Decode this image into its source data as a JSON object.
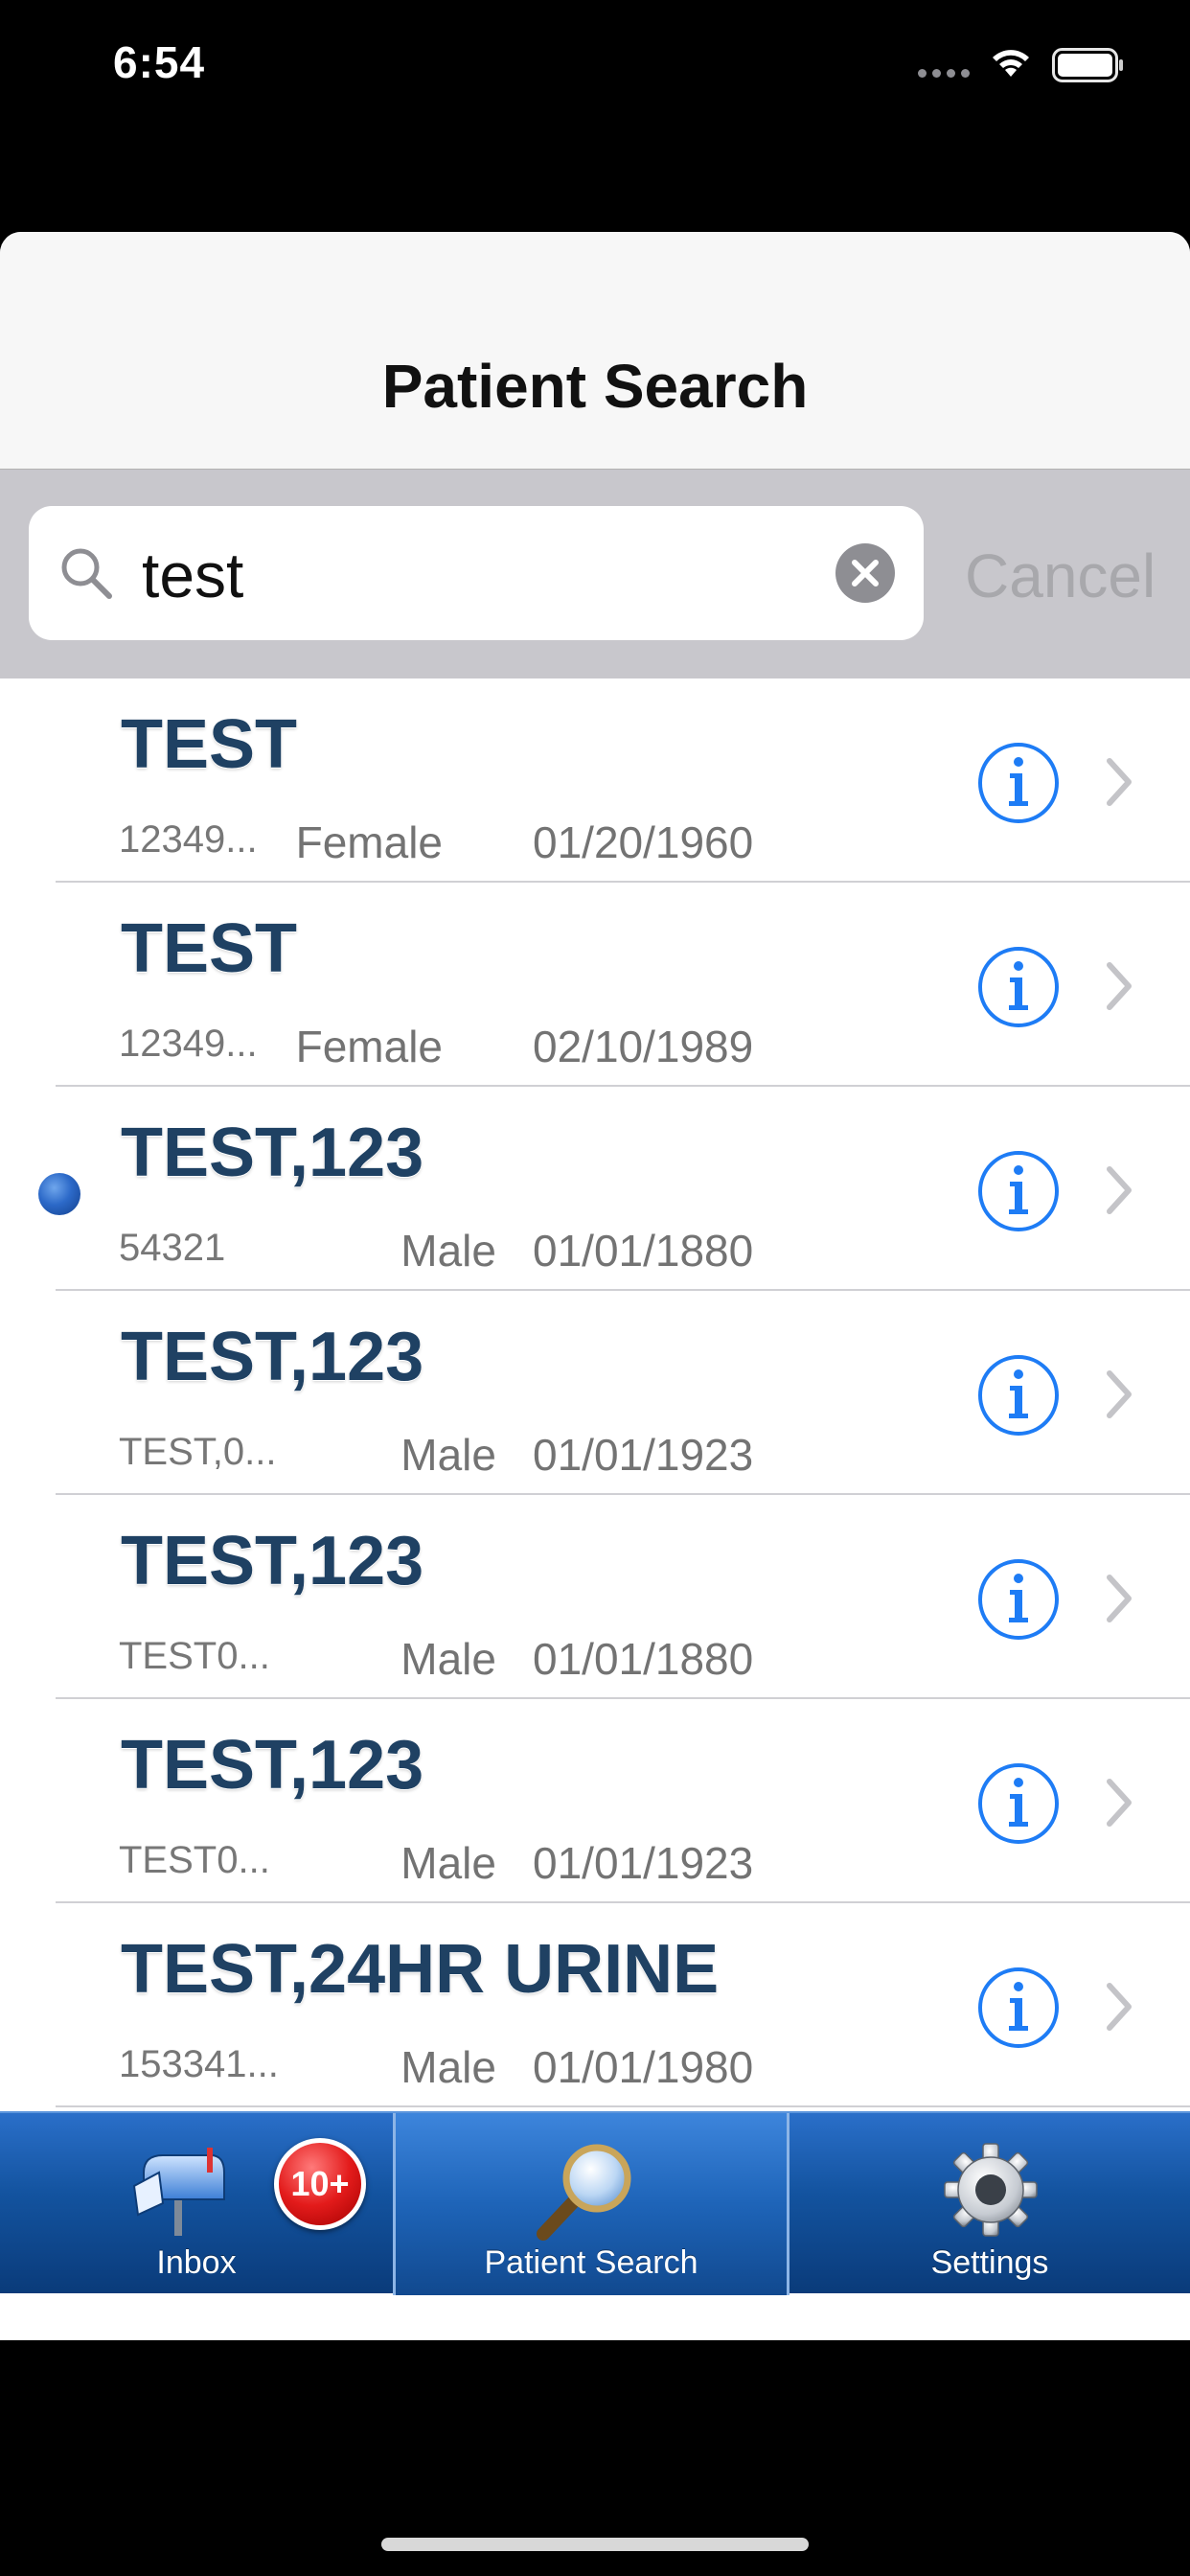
{
  "status_bar": {
    "time": "6:54"
  },
  "nav": {
    "title": "Patient Search"
  },
  "search": {
    "query": "test",
    "cancel_label": "Cancel"
  },
  "patients": [
    {
      "name": "TEST",
      "id": "12349...",
      "gender": "Female",
      "dob": "01/20/1960",
      "selected": false
    },
    {
      "name": "TEST",
      "id": "12349...",
      "gender": "Female",
      "dob": "02/10/1989",
      "selected": false
    },
    {
      "name": "TEST,123",
      "id": "54321",
      "gender": "Male",
      "dob": "01/01/1880",
      "selected": true
    },
    {
      "name": "TEST,123",
      "id": "TEST,0...",
      "gender": "Male",
      "dob": "01/01/1923",
      "selected": false
    },
    {
      "name": "TEST,123",
      "id": "TEST0...",
      "gender": "Male",
      "dob": "01/01/1880",
      "selected": false
    },
    {
      "name": "TEST,123",
      "id": "TEST0...",
      "gender": "Male",
      "dob": "01/01/1923",
      "selected": false
    },
    {
      "name": "TEST,24HR URINE",
      "id": "153341...",
      "gender": "Male",
      "dob": "01/01/1980",
      "selected": false
    }
  ],
  "tabs": {
    "inbox": {
      "label": "Inbox",
      "badge": "10+"
    },
    "patient_search": {
      "label": "Patient Search"
    },
    "settings": {
      "label": "Settings"
    }
  },
  "colors": {
    "name_text": "#1f4163",
    "info_blue": "#1e7cf5",
    "tab_bar_blue": "#13539f",
    "selected_dot": "#2c69c8",
    "badge_red": "#e31b1b"
  },
  "icons": {
    "row_info": "info-icon",
    "row_chevron": "chevron-right-icon",
    "search": "search-icon",
    "clear": "clear-icon",
    "inbox": "mailbox-icon",
    "patient_search": "magnifier-icon",
    "settings": "gear-icon"
  }
}
